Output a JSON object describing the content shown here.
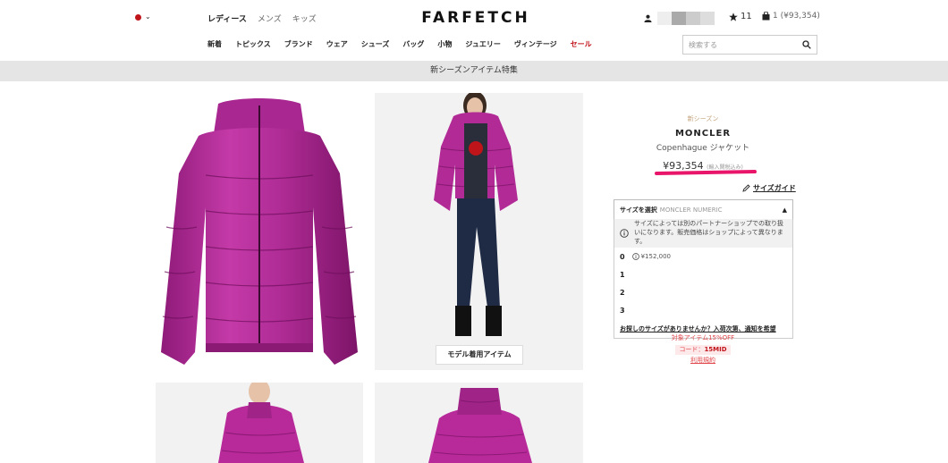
{
  "header": {
    "gender_tabs": [
      "レディース",
      "メンズ",
      "キッズ"
    ],
    "logo": "FARFETCH",
    "wishlist_count": "11",
    "bag_summary": "1 (¥93,354)",
    "nav": [
      "新着",
      "トピックス",
      "ブランド",
      "ウェア",
      "シューズ",
      "バッグ",
      "小物",
      "ジュエリー",
      "ヴィンテージ",
      "セール"
    ],
    "search_placeholder": "検索する"
  },
  "banner": "新シーズンアイテム特集",
  "gallery": {
    "model_button": "モデル着用アイテム"
  },
  "product": {
    "badge": "新シーズン",
    "brand": "MONCLER",
    "name": "Copenhague ジャケット",
    "price": "¥93,354",
    "price_note": "(輸入関税込み)",
    "size_guide": "サイズガイド"
  },
  "size_selector": {
    "label": "サイズを選択",
    "scale": "MONCLER NUMERIC",
    "notice": "サイズによっては別のパートナーショップでの取り扱いになります。販売価格はショップによって異なります。",
    "options": [
      {
        "size": "0",
        "alt_price": "¥152,000"
      },
      {
        "size": "1",
        "alt_price": ""
      },
      {
        "size": "2",
        "alt_price": ""
      },
      {
        "size": "3",
        "alt_price": ""
      }
    ],
    "notify_link": "お探しのサイズがありませんか？入荷次第、通知を希望"
  },
  "promo": {
    "line1": "対象アイテム15%OFF",
    "code_label": "コード：",
    "code": "15MID",
    "terms": "利用規約"
  },
  "colors": {
    "jacket": "#b82a9a",
    "sale": "#c0141b",
    "highlight": "#e8156a"
  }
}
